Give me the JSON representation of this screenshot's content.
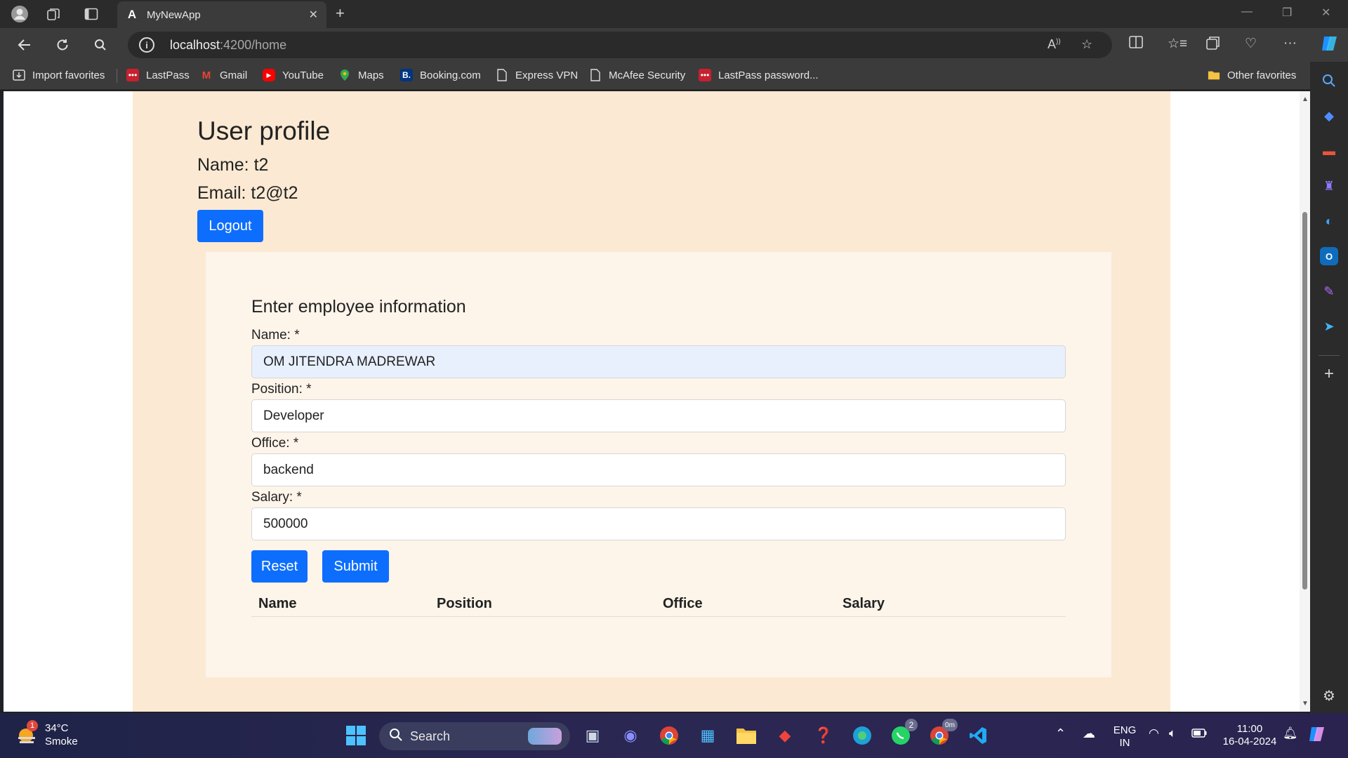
{
  "browser": {
    "tab_title": "MyNewApp",
    "url_host": "localhost",
    "url_path": ":4200/home",
    "favorites": [
      {
        "label": "Import favorites",
        "icon": "import-icon"
      },
      {
        "label": "LastPass",
        "icon": "lastpass-icon"
      },
      {
        "label": "Gmail",
        "icon": "gmail-icon"
      },
      {
        "label": "YouTube",
        "icon": "youtube-icon"
      },
      {
        "label": "Maps",
        "icon": "maps-icon"
      },
      {
        "label": "Booking.com",
        "icon": "booking-icon"
      },
      {
        "label": "Express VPN",
        "icon": "page-icon"
      },
      {
        "label": "McAfee Security",
        "icon": "page-icon"
      },
      {
        "label": "LastPass password...",
        "icon": "lastpass-icon"
      }
    ],
    "other_favorites": "Other favorites"
  },
  "profile": {
    "title": "User profile",
    "name_line": "Name: t2",
    "email_line": "Email: t2@t2",
    "logout_label": "Logout"
  },
  "form": {
    "title": "Enter employee information",
    "name_label": "Name: *",
    "name_value": "OM JITENDRA MADREWAR",
    "position_label": "Position: *",
    "position_value": "Developer",
    "office_label": "Office: *",
    "office_value": "backend",
    "salary_label": "Salary: *",
    "salary_value": "500000",
    "reset_label": "Reset",
    "submit_label": "Submit"
  },
  "table": {
    "headers": [
      "Name",
      "Position",
      "Office",
      "Salary"
    ]
  },
  "taskbar": {
    "weather_temp": "34°C",
    "weather_desc": "Smoke",
    "weather_badge": "1",
    "search_label": "Search",
    "lang_top": "ENG",
    "lang_bottom": "IN",
    "time": "11:00",
    "date": "16-04-2024",
    "whatsapp_badge": "2",
    "chrome_badge": "0m"
  },
  "colors": {
    "accent": "#0d6efd",
    "page_bg": "#fbe9d3",
    "card_bg": "#fdf4ea",
    "autofill_bg": "#e8f0fe"
  }
}
